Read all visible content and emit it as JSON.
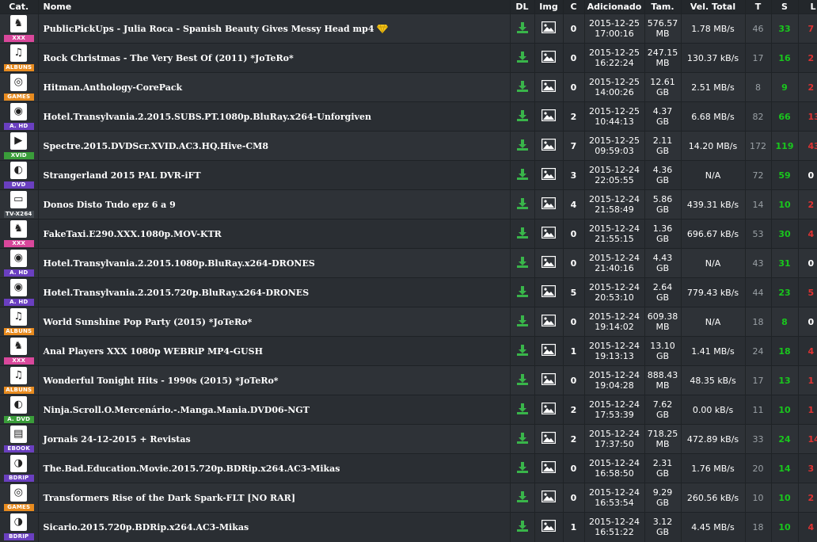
{
  "headers": {
    "cat": "Cat.",
    "name": "Nome",
    "dl": "DL",
    "img": "Img",
    "c": "C",
    "added": "Adicionado",
    "size": "Tam.",
    "speed": "Vel. Total",
    "t": "T",
    "s": "S",
    "l": "L"
  },
  "colors": {
    "XXX": "#d9479b",
    "ALBUNS": "#e88b1f",
    "GAMES": "#e88b1f",
    "A. HD": "#6a3fc0",
    "XVID": "#3a9d3a",
    "DVD": "#6a3fc0",
    "TV-X264": "#444a50",
    "A. DVD": "#3a9d3a",
    "EBOOK": "#6a3fc0",
    "BDRIP": "#6a3fc0"
  },
  "rows": [
    {
      "cat": "XXX",
      "icon": "bunny-icon",
      "name": "PublicPickUps - Julia Roca - Spanish Beauty Gives Messy Head mp4",
      "badge": true,
      "c": "0",
      "date": "2015-12-25",
      "time": "17:00:16",
      "size1": "576.57",
      "size2": "MB",
      "speed": "1.78 MB/s",
      "t": "46",
      "s": "33",
      "l": "7"
    },
    {
      "cat": "ALBUNS",
      "icon": "headphones-icon",
      "name": "Rock Christmas - The Very Best Of (2011) *JoTeRo*",
      "badge": false,
      "c": "0",
      "date": "2015-12-25",
      "time": "16:22:24",
      "size1": "247.15",
      "size2": "MB",
      "speed": "130.37 kB/s",
      "t": "17",
      "s": "16",
      "l": "2"
    },
    {
      "cat": "GAMES",
      "icon": "disc-icon",
      "name": "Hitman.Anthology-CorePack",
      "badge": false,
      "c": "0",
      "date": "2015-12-25",
      "time": "14:00:26",
      "size1": "12.61",
      "size2": "GB",
      "speed": "2.51 MB/s",
      "t": "8",
      "s": "9",
      "l": "2"
    },
    {
      "cat": "A. HD",
      "icon": "hd-disc-icon",
      "name": "Hotel.Transylvania.2.2015.SUBS.PT.1080p.BluRay.x264-Unforgiven",
      "badge": false,
      "c": "2",
      "date": "2015-12-25",
      "time": "10:44:13",
      "size1": "4.37",
      "size2": "GB",
      "speed": "6.68 MB/s",
      "t": "82",
      "s": "66",
      "l": "13"
    },
    {
      "cat": "XVID",
      "icon": "film-icon",
      "name": "Spectre.2015.DVDScr.XVID.AC3.HQ.Hive-CM8",
      "badge": false,
      "c": "7",
      "date": "2015-12-25",
      "time": "09:59:03",
      "size1": "2.11",
      "size2": "GB",
      "speed": "14.20 MB/s",
      "t": "172",
      "s": "119",
      "l": "43"
    },
    {
      "cat": "DVD",
      "icon": "dvd-icon",
      "name": "Strangerland 2015 PAL DVR-iFT",
      "badge": false,
      "c": "3",
      "date": "2015-12-24",
      "time": "22:05:55",
      "size1": "4.36",
      "size2": "GB",
      "speed": "N/A",
      "t": "72",
      "s": "59",
      "l": "0"
    },
    {
      "cat": "TV-X264",
      "icon": "tv-icon",
      "name": "Donos Disto Tudo epz 6 a 9",
      "badge": false,
      "c": "4",
      "date": "2015-12-24",
      "time": "21:58:49",
      "size1": "5.86",
      "size2": "GB",
      "speed": "439.31 kB/s",
      "t": "14",
      "s": "10",
      "l": "2"
    },
    {
      "cat": "XXX",
      "icon": "bunny-icon",
      "name": "FakeTaxi.E290.XXX.1080p.MOV-KTR",
      "badge": false,
      "c": "0",
      "date": "2015-12-24",
      "time": "21:55:15",
      "size1": "1.36",
      "size2": "GB",
      "speed": "696.67 kB/s",
      "t": "53",
      "s": "30",
      "l": "4"
    },
    {
      "cat": "A. HD",
      "icon": "hd-disc-icon",
      "name": "Hotel.Transylvania.2.2015.1080p.BluRay.x264-DRONES",
      "badge": false,
      "c": "0",
      "date": "2015-12-24",
      "time": "21:40:16",
      "size1": "4.43",
      "size2": "GB",
      "speed": "N/A",
      "t": "43",
      "s": "31",
      "l": "0"
    },
    {
      "cat": "A. HD",
      "icon": "hd-disc-icon",
      "name": "Hotel.Transylvania.2.2015.720p.BluRay.x264-DRONES",
      "badge": false,
      "c": "5",
      "date": "2015-12-24",
      "time": "20:53:10",
      "size1": "2.64",
      "size2": "GB",
      "speed": "779.43 kB/s",
      "t": "44",
      "s": "23",
      "l": "5"
    },
    {
      "cat": "ALBUNS",
      "icon": "headphones-icon",
      "name": "World Sunshine Pop Party (2015) *JoTeRo*",
      "badge": false,
      "c": "0",
      "date": "2015-12-24",
      "time": "19:14:02",
      "size1": "609.38",
      "size2": "MB",
      "speed": "N/A",
      "t": "18",
      "s": "8",
      "l": "0"
    },
    {
      "cat": "XXX",
      "icon": "bunny-icon",
      "name": "Anal Players XXX 1080p WEBRiP MP4-GUSH",
      "badge": false,
      "c": "1",
      "date": "2015-12-24",
      "time": "19:13:13",
      "size1": "13.10",
      "size2": "GB",
      "speed": "1.41 MB/s",
      "t": "24",
      "s": "18",
      "l": "4"
    },
    {
      "cat": "ALBUNS",
      "icon": "headphones-icon",
      "name": "Wonderful Tonight Hits - 1990s (2015) *JoTeRo*",
      "badge": false,
      "c": "0",
      "date": "2015-12-24",
      "time": "19:04:28",
      "size1": "888.43",
      "size2": "MB",
      "speed": "48.35 kB/s",
      "t": "17",
      "s": "13",
      "l": "1"
    },
    {
      "cat": "A. DVD",
      "icon": "dvd-icon",
      "name": "Ninja.Scroll.O.Mercenário.-.Manga.Mania.DVD06-NGT",
      "badge": false,
      "c": "2",
      "date": "2015-12-24",
      "time": "17:53:39",
      "size1": "7.62",
      "size2": "GB",
      "speed": "0.00 kB/s",
      "t": "11",
      "s": "10",
      "l": "1"
    },
    {
      "cat": "EBOOK",
      "icon": "book-icon",
      "name": "Jornais 24-12-2015 + Revistas",
      "badge": false,
      "c": "2",
      "date": "2015-12-24",
      "time": "17:37:50",
      "size1": "718.25",
      "size2": "MB",
      "speed": "472.89 kB/s",
      "t": "33",
      "s": "24",
      "l": "14"
    },
    {
      "cat": "BDRIP",
      "icon": "bd-disc-icon",
      "name": "The.Bad.Education.Movie.2015.720p.BDRip.x264.AC3-Mikas",
      "badge": false,
      "c": "0",
      "date": "2015-12-24",
      "time": "16:58:50",
      "size1": "2.31",
      "size2": "GB",
      "speed": "1.76 MB/s",
      "t": "20",
      "s": "14",
      "l": "3"
    },
    {
      "cat": "GAMES",
      "icon": "disc-icon",
      "name": "Transformers Rise of the Dark Spark-FLT [NO RAR]",
      "badge": false,
      "c": "0",
      "date": "2015-12-24",
      "time": "16:53:54",
      "size1": "9.29",
      "size2": "GB",
      "speed": "260.56 kB/s",
      "t": "10",
      "s": "10",
      "l": "2"
    },
    {
      "cat": "BDRIP",
      "icon": "bd-disc-icon",
      "name": "Sicario.2015.720p.BDRip.x264.AC3-Mikas",
      "badge": false,
      "c": "1",
      "date": "2015-12-24",
      "time": "16:51:22",
      "size1": "3.12",
      "size2": "GB",
      "speed": "4.45 MB/s",
      "t": "18",
      "s": "10",
      "l": "4"
    }
  ]
}
